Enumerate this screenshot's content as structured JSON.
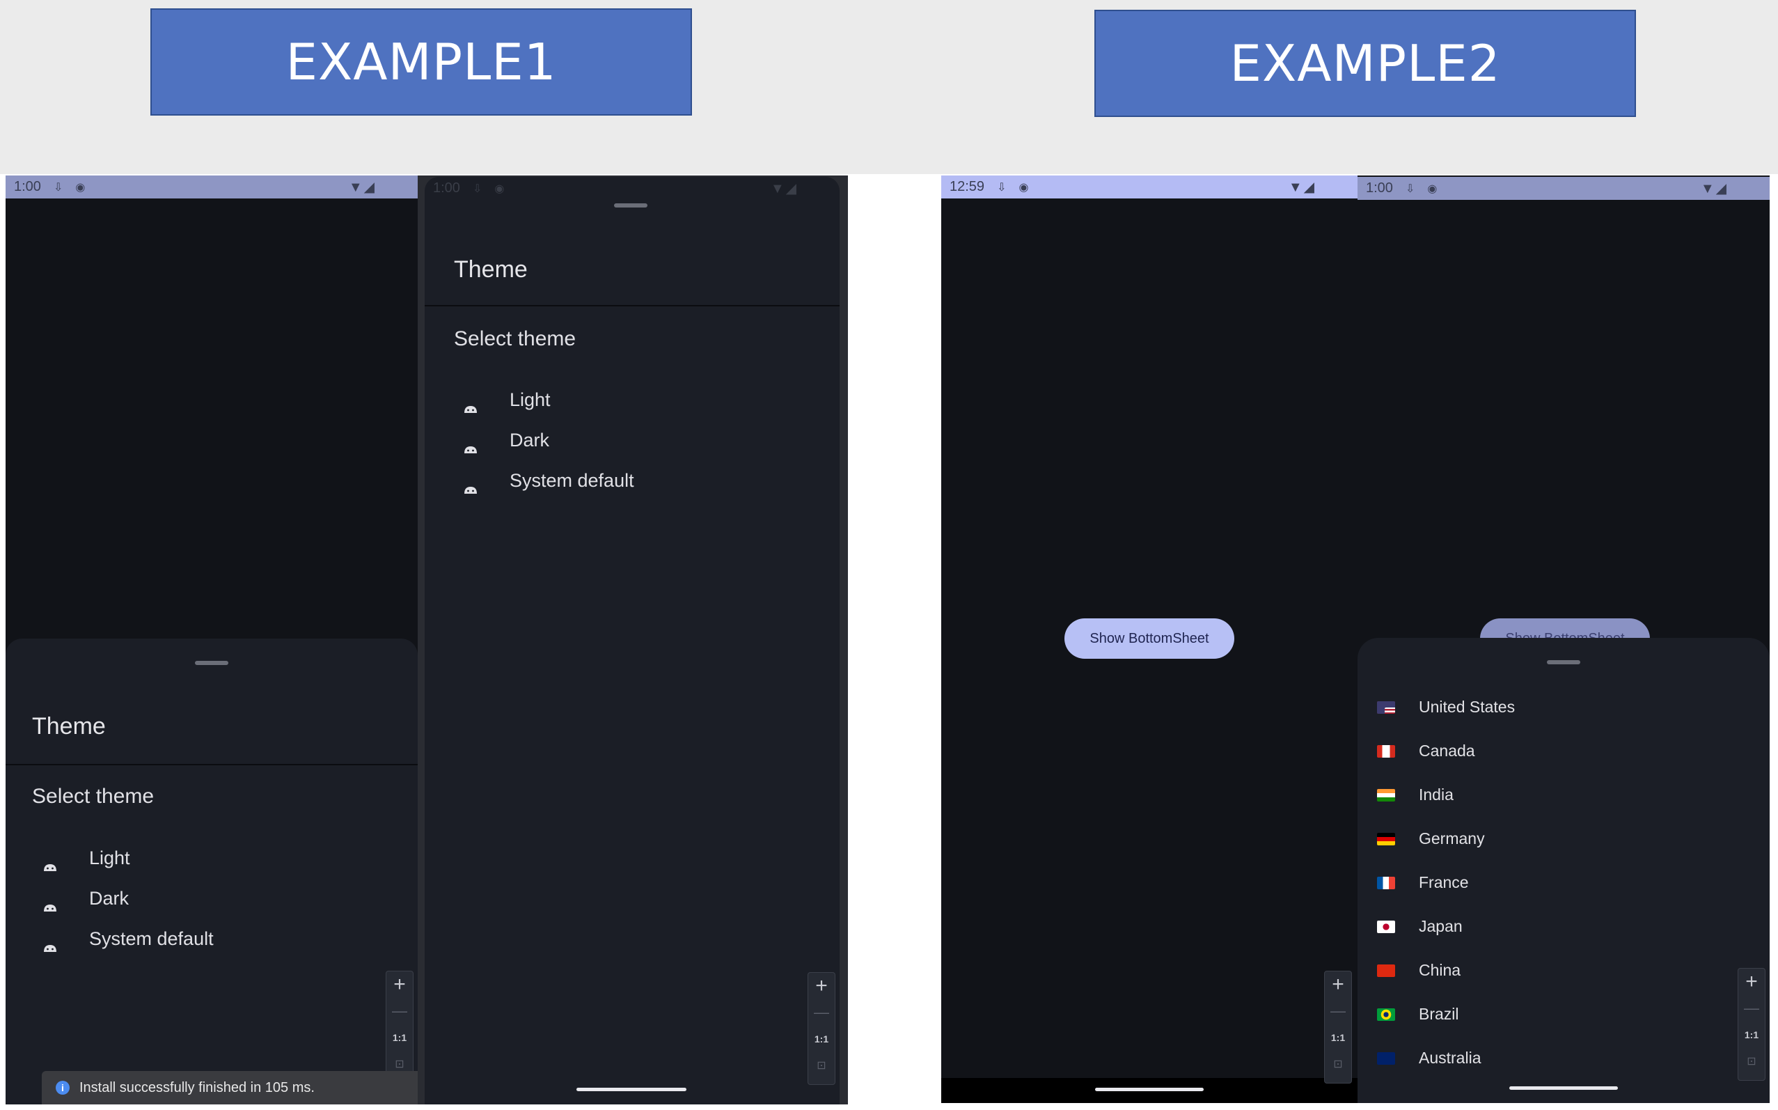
{
  "banners": {
    "example1": "EXAMPLE1",
    "example2": "EXAMPLE2"
  },
  "phone1": {
    "status_time": "1:00",
    "sheet": {
      "title": "Theme",
      "subtitle": "Select theme",
      "options": [
        "Light",
        "Dark",
        "System default"
      ]
    },
    "toast": "Install successfully finished in 105 ms."
  },
  "phone2": {
    "status_time": "1:00",
    "sheet": {
      "title": "Theme",
      "subtitle": "Select theme",
      "options": [
        "Light",
        "Dark",
        "System default"
      ]
    }
  },
  "phone3": {
    "status_time": "12:59",
    "button_label": "Show BottomSheet"
  },
  "phone4": {
    "status_time": "1:00",
    "button_label": "Show BottomSheet",
    "countries": [
      "United States",
      "Canada",
      "India",
      "Germany",
      "France",
      "Japan",
      "China",
      "Brazil",
      "Australia"
    ]
  },
  "zoom_controls": {
    "plus": "+",
    "minus": "—",
    "one_to_one": "1:1",
    "fit": "⊡"
  },
  "icons": {
    "status": [
      "download-icon",
      "record-icon",
      "wifi-icon",
      "signal-icon"
    ],
    "option": "android-icon",
    "flags": [
      "flag-us-icon",
      "flag-ca-icon",
      "flag-in-icon",
      "flag-de-icon",
      "flag-fr-icon",
      "flag-jp-icon",
      "flag-cn-icon",
      "flag-br-icon",
      "flag-au-icon"
    ]
  },
  "colors": {
    "accent": "#4f72c0",
    "sheet": "#1b1e26",
    "button": "#b7c0f5",
    "statusbar": "#8e96c4"
  }
}
